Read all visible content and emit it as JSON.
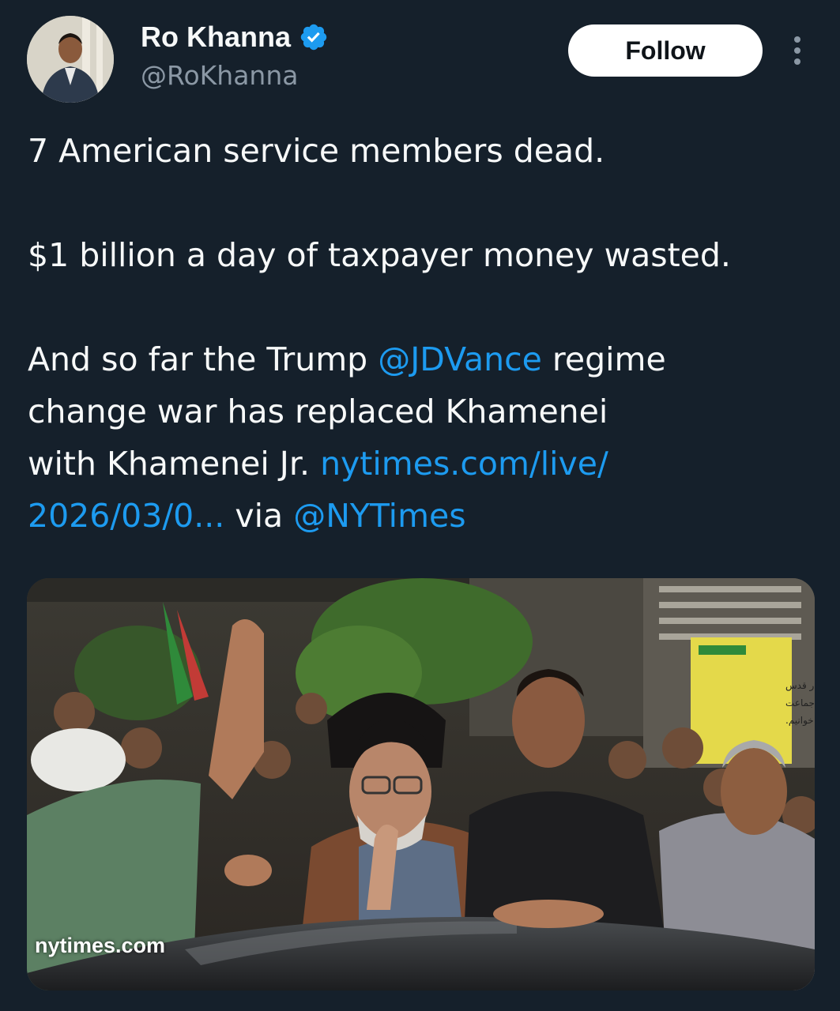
{
  "author": {
    "display_name": "Ro Khanna",
    "handle": "@RoKhanna",
    "verified": true,
    "avatar_icon": "profile-photo"
  },
  "actions": {
    "follow_label": "Follow",
    "more_icon": "more-vertical-icon"
  },
  "tweet": {
    "line1": "7 American service members dead.",
    "line2": "$1 billion a day of taxpayer money wasted.",
    "line3_pre": "And so far the Trump ",
    "mention_vance": "@JDVance",
    "line3_post": " regime",
    "line4": "change war has replaced Khamenei",
    "line5_pre": "with Khamenei Jr. ",
    "link_part1": "nytimes.com/live/",
    "link_part2": "2026/03/0...",
    "via": " via ",
    "mention_nyt": "@NYTimes"
  },
  "media": {
    "source": "nytimes.com",
    "sign_lines": [
      "به زودی در قدس",
      "نماز جماعت",
      "می خوانیم."
    ]
  },
  "colors": {
    "background": "#15202b",
    "text": "#f7f9f9",
    "secondary": "#8b98a5",
    "link": "#1d9bf0",
    "verified": "#1d9bf0"
  }
}
